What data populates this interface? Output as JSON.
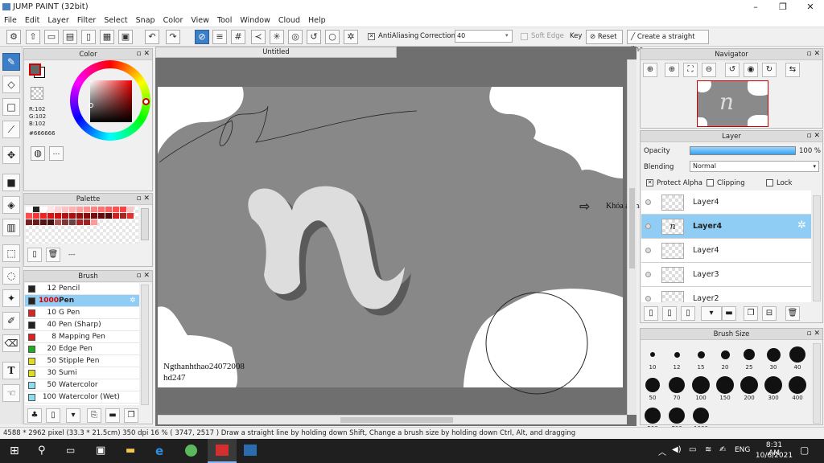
{
  "window": {
    "title": "JUMP PAINT (32bit)",
    "minimize": "–",
    "maximize": "❐",
    "close": "✕"
  },
  "menu": [
    "File",
    "Edit",
    "Layer",
    "Filter",
    "Select",
    "Snap",
    "Color",
    "View",
    "Tool",
    "Window",
    "Cloud",
    "Help"
  ],
  "toolbar": {
    "antialiasing_label": "AntiAliasing",
    "correction_label": "Correction",
    "correction_value": "40",
    "soft_edge_label": "Soft Edge",
    "key_label": "Key",
    "reset_label": "Reset",
    "straight_line_label": "Create a straight line"
  },
  "color_panel": {
    "title": "Color",
    "r": "R:102",
    "g": "G:102",
    "b": "B:102",
    "hex": "#666666",
    "main_color": "#666666"
  },
  "palette_panel": {
    "title": "Palette",
    "dash": "---"
  },
  "brush_panel": {
    "title": "Brush",
    "items": [
      {
        "size": "12",
        "name": "Pencil",
        "color": "#222222"
      },
      {
        "size": "1000",
        "name": "Pen",
        "color": "#222222"
      },
      {
        "size": "10",
        "name": "G Pen",
        "color": "#dd2222"
      },
      {
        "size": "40",
        "name": "Pen (Sharp)",
        "color": "#222222"
      },
      {
        "size": "8",
        "name": "Mapping Pen",
        "color": "#dd2222"
      },
      {
        "size": "20",
        "name": "Edge Pen",
        "color": "#22aa22"
      },
      {
        "size": "50",
        "name": "Stipple Pen",
        "color": "#dddd22"
      },
      {
        "size": "30",
        "name": "Sumi",
        "color": "#dddd22"
      },
      {
        "size": "50",
        "name": "Watercolor",
        "color": "#88ddee"
      },
      {
        "size": "100",
        "name": "Watercolor (Wet)",
        "color": "#88ddee"
      }
    ]
  },
  "document": {
    "tab": "Untitled",
    "caption_line1": "Ngthanhthao24072008",
    "caption_line2": "hd247",
    "annotation": "Khóa alpha"
  },
  "navigator": {
    "title": "Navigator"
  },
  "layer_panel": {
    "title": "Layer",
    "opacity_label": "Opacity",
    "opacity_value": "100 %",
    "opacity_percent": 100,
    "blending_label": "Blending",
    "blending_value": "Normal",
    "protect_alpha": "Protect Alpha",
    "clipping": "Clipping",
    "lock": "Lock",
    "layers": [
      "Layer4",
      "Layer4",
      "Layer4",
      "Layer3",
      "Layer2"
    ]
  },
  "brush_size_panel": {
    "title": "Brush Size",
    "sizes": [
      "10",
      "12",
      "15",
      "20",
      "25",
      "30",
      "40",
      "50",
      "70",
      "100",
      "150",
      "200",
      "300",
      "400",
      "500",
      "700",
      "1000"
    ]
  },
  "status": {
    "text": "4588 * 2962 pixel   (33.3 * 21.5cm)   350 dpi   16 %   ( 3747, 2517 )   Draw a straight line by holding down Shift, Change a brush size by holding down Ctrl, Alt, and dragging"
  },
  "taskbar": {
    "time": "8:31 AM",
    "date": "10/6/2021",
    "lang": "ENG"
  }
}
